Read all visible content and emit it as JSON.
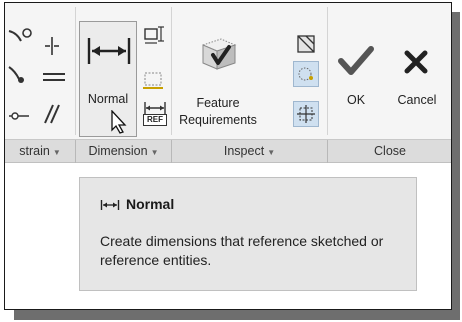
{
  "ribbon": {
    "buttons": {
      "normal_label": "Normal",
      "feature_requirements_label": "Feature Requirements",
      "ok_label": "OK",
      "cancel_label": "Cancel",
      "ref_dim_text": "REF"
    },
    "groups": [
      {
        "name": "constrain",
        "label": "strain"
      },
      {
        "name": "dimension",
        "label": "Dimension"
      },
      {
        "name": "inspect",
        "label": "Inspect"
      },
      {
        "name": "close",
        "label": "Close"
      }
    ],
    "group_dropdown_glyph": "▼"
  },
  "tooltip": {
    "title": "Normal",
    "description": "Create dimensions that reference sketched or reference entities."
  },
  "icons": [
    "tangent-icon",
    "vertical-icon",
    "horizontal-icon",
    "parallel-icon",
    "point-on-entity-icon",
    "normal-dimension-icon",
    "perimeter-icon",
    "baseline-icon",
    "reference-dimension-icon",
    "feature-requirements-icon",
    "overlapping-geometry-icon",
    "shade-closed-loops-icon",
    "highlight-open-ends-icon",
    "ok-check-icon",
    "cancel-x-icon",
    "mouse-cursor-icon"
  ],
  "colors": {
    "ribbon_bg": "#f5f5f5",
    "groupbar_bg": "#dcdcdc",
    "ok_check": "#555555",
    "cancel_x": "#222222",
    "tooltip_bg": "#e6e6e6"
  }
}
